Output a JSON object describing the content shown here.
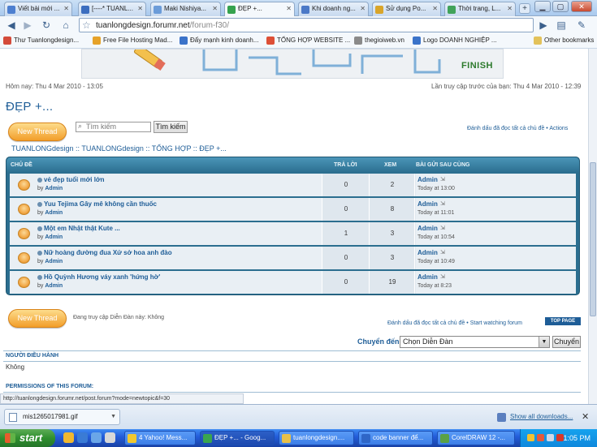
{
  "browser": {
    "tabs": [
      {
        "label": "Viết bài mới ...",
        "color": "#4d7fd0",
        "active": false
      },
      {
        "label": "[----* TUANL...",
        "color": "#3b6dbf",
        "active": false
      },
      {
        "label": "Maki Nishiya...",
        "color": "#6b9cd9",
        "active": false
      },
      {
        "label": "ĐẸP +...",
        "color": "#35a24e",
        "active": true
      },
      {
        "label": "Khi doanh ng...",
        "color": "#4b79c7",
        "active": false
      },
      {
        "label": "Sử dụng Po...",
        "color": "#d9a52a",
        "active": false
      },
      {
        "label": "Thời trang, L...",
        "color": "#41a35a",
        "active": false
      }
    ],
    "new_tab_label": "+",
    "window_buttons": {
      "minimize": "▁",
      "maximize": "▢",
      "close": "✕"
    },
    "url_host": "tuanlongdesign.forumr.net",
    "url_path": "/forum-f30/",
    "bookmarks": [
      {
        "label": "Thư Tuanlongdesign...",
        "color": "#d44b3a"
      },
      {
        "label": "Free File Hosting Mad...",
        "color": "#e6a229"
      },
      {
        "label": "Đẩy mạnh kinh doanh...",
        "color": "#3b73c9"
      },
      {
        "label": "TỔNG HỢP WEBSITE ...",
        "color": "#dd4f36"
      },
      {
        "label": "thegioiweb.vn",
        "color": "#8a8a8a"
      },
      {
        "label": "Logo DOANH NGHIỆP ...",
        "color": "#3b73c9"
      }
    ],
    "other_bookmarks": "Other bookmarks"
  },
  "page": {
    "banner_finish": "FINISH",
    "today": "Hôm nay: Thu 4 Mar 2010 - 13:05",
    "last_visit": "Lần truy cập trước của bạn: Thu 4 Mar 2010 - 12:39",
    "forum_title": "ĐẸP +...",
    "new_thread_label": "New Thread",
    "search_placeholder": "Tìm kiếm",
    "search_button": "Tìm kiếm",
    "mark_read_top": "Đánh dấu đã đọc tất cả chủ đề",
    "actions_label": "Actions",
    "breadcrumb": "TUANLONGdesign :: TUANLONGdesign :: TỔNG HỢP :: ĐẸP +...",
    "headers": {
      "topic": "CHỦ ĐỀ",
      "replies": "TRẢ LỜI",
      "views": "XEM",
      "last_post": "BÀI GỬI SAU CÙNG"
    },
    "topics": [
      {
        "title": "vẻ đẹp tuổi mới lớn",
        "by": "by",
        "author": "Admin",
        "replies": "0",
        "views": "2",
        "last_author": "Admin",
        "last_time": "Today at 13:00"
      },
      {
        "title": "Yuu Tejima Gây mê không cần thuốc",
        "by": "by",
        "author": "Admin",
        "replies": "0",
        "views": "8",
        "last_author": "Admin",
        "last_time": "Today at 11:01"
      },
      {
        "title": "Một em Nhật thật Kute ...",
        "by": "by",
        "author": "Admin",
        "replies": "1",
        "views": "3",
        "last_author": "Admin",
        "last_time": "Today at 10:54"
      },
      {
        "title": "Nữ hoàng đường đua Xứ sở hoa anh đào",
        "by": "by",
        "author": "Admin",
        "replies": "0",
        "views": "3",
        "last_author": "Admin",
        "last_time": "Today at 10:49"
      },
      {
        "title": "Hồ Quỳnh Hương váy xanh 'hứng hờ'",
        "by": "by",
        "author": "Admin",
        "replies": "0",
        "views": "19",
        "last_author": "Admin",
        "last_time": "Today at 8:23"
      }
    ],
    "viewing": "Đang truy cập Diễn Đàn này: Không",
    "mark_read_bottom": "Đánh dấu đã đọc tất cả chủ đề",
    "start_watching": "Start watching forum",
    "top_page": "TOP PAGE",
    "jump_label": "Chuyển đến:",
    "jump_select_value": "Chọn Diễn Đàn",
    "jump_button": "Chuyển",
    "moderators_header": "NGƯỜI ĐIỀU HÀNH",
    "moderators_value": "Không",
    "permissions_header": "PERMISSIONS OF THIS FORUM:"
  },
  "status_url": "http://tuanlongdesign.forumr.net/post.forum?mode=newtopic&f=30",
  "downloads": {
    "item_name": "mis1265017981.gif",
    "show_all": "Show all downloads...",
    "close": "✕"
  },
  "taskbar": {
    "start": "start",
    "tasks": [
      {
        "label": "4 Yahoo! Mess...",
        "color": "#f0c82f",
        "active": false
      },
      {
        "label": "ĐẸP +... - Goog...",
        "color": "#3aa54f",
        "active": true
      },
      {
        "label": "tuanlongdesign....",
        "color": "#e8c04a",
        "active": false
      },
      {
        "label": "code banner để...",
        "color": "#2f66c7",
        "active": false
      },
      {
        "label": "CorelDRAW 12 -...",
        "color": "#5aa146",
        "active": false
      }
    ],
    "clock": "1:05 PM"
  }
}
